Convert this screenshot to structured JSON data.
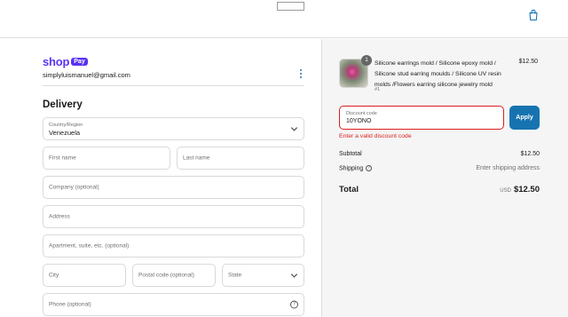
{
  "header": {
    "cart_icon": "shopping-bag-icon"
  },
  "account": {
    "shop_word": "shop",
    "pay_badge": "Pay",
    "email": "simplyluismanuel@gmail.com",
    "menu_icon": "kebab-icon"
  },
  "delivery": {
    "heading": "Delivery",
    "country_label": "Country/Region",
    "country_value": "Venezuela",
    "first_name_ph": "First name",
    "last_name_ph": "Last name",
    "company_ph": "Company (optional)",
    "address_ph": "Address",
    "apartment_ph": "Apartment, suite, etc. (optional)",
    "city_ph": "City",
    "postal_ph": "Postal code (optional)",
    "state_ph": "State",
    "phone_ph": "Phone (optional)",
    "help_icon": "?"
  },
  "order": {
    "quantity": "1",
    "product_title": "Silicone earrings mold / Silicone epoxy mold / Silicone stud earring moulds / Silicone UV resin molds /Flowers earring silicone jewelry mold",
    "variant": "#1",
    "price": "$12.50",
    "discount_label": "Discount code",
    "discount_value": "10YONO",
    "apply_label": "Apply",
    "error": "Enter a valid discount code",
    "subtotal_label": "Subtotal",
    "subtotal_value": "$12.50",
    "shipping_label": "Shipping",
    "shipping_icon": "?",
    "shipping_value": "Enter shipping address",
    "total_label": "Total",
    "total_currency": "USD",
    "total_value": "$12.50"
  },
  "colors": {
    "shop_purple": "#5a31f4",
    "accent_blue": "#1773b0",
    "error_red": "#dd1d1d"
  }
}
